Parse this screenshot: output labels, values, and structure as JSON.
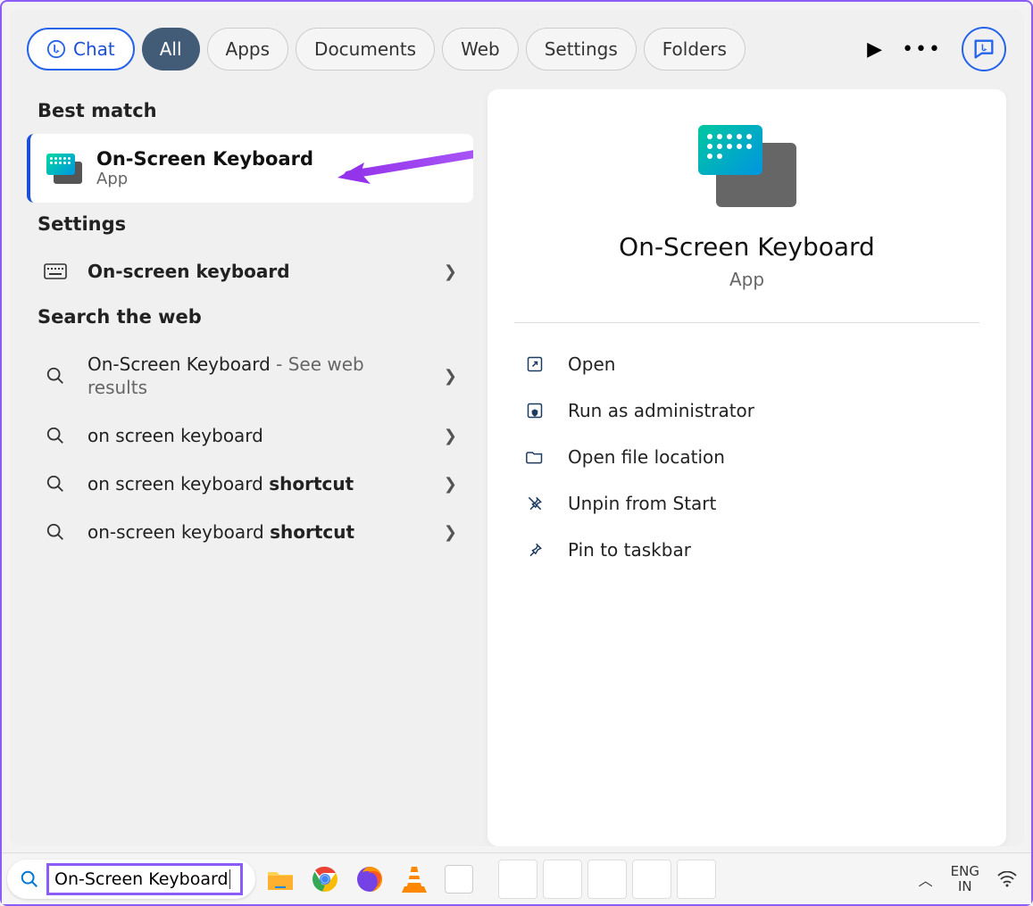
{
  "tabs": {
    "chat": "Chat",
    "all": "All",
    "apps": "Apps",
    "documents": "Documents",
    "web": "Web",
    "settings": "Settings",
    "folders": "Folders"
  },
  "sections": {
    "best_match": "Best match",
    "settings": "Settings",
    "search_web": "Search the web"
  },
  "best_match": {
    "title": "On-Screen Keyboard",
    "subtitle": "App"
  },
  "settings_items": [
    {
      "label": "On-screen keyboard"
    }
  ],
  "web_items": [
    {
      "primary": "On-Screen Keyboard",
      "hint": " - See web results"
    },
    {
      "primary": "on screen keyboard",
      "bold": ""
    },
    {
      "primary": "on screen keyboard ",
      "bold": "shortcut"
    },
    {
      "primary": "on-screen keyboard ",
      "bold": "shortcut"
    }
  ],
  "detail": {
    "title": "On-Screen Keyboard",
    "subtitle": "App",
    "actions": [
      {
        "icon": "open",
        "label": "Open"
      },
      {
        "icon": "shield",
        "label": "Run as administrator"
      },
      {
        "icon": "folder",
        "label": "Open file location"
      },
      {
        "icon": "unpin",
        "label": "Unpin from Start"
      },
      {
        "icon": "pin",
        "label": "Pin to taskbar"
      }
    ]
  },
  "taskbar": {
    "search_value": "On-Screen Keyboard",
    "lang_top": "ENG",
    "lang_bottom": "IN"
  }
}
